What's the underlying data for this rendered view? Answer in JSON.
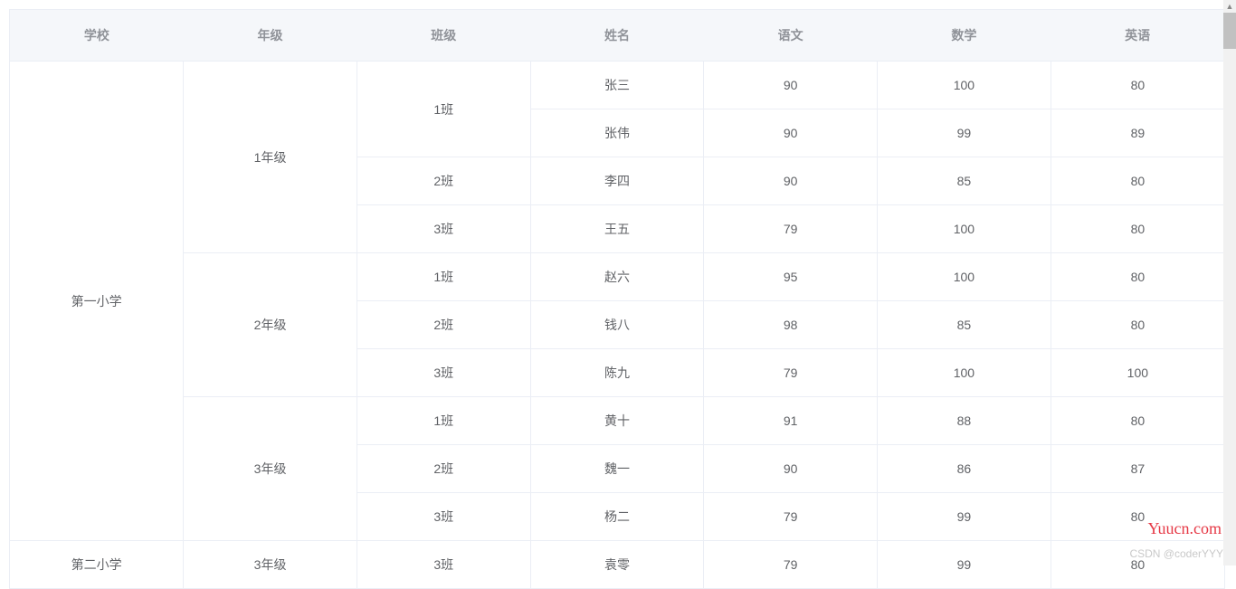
{
  "table": {
    "headers": [
      "学校",
      "年级",
      "班级",
      "姓名",
      "语文",
      "数学",
      "英语"
    ],
    "rows": [
      {
        "school": "第一小学",
        "schoolRowspan": 10,
        "grade": "1年级",
        "gradeRowspan": 4,
        "class": "1班",
        "classRowspan": 2,
        "name": "张三",
        "chinese": "90",
        "math": "100",
        "english": "80"
      },
      {
        "name": "张伟",
        "chinese": "90",
        "math": "99",
        "english": "89"
      },
      {
        "class": "2班",
        "classRowspan": 1,
        "name": "李四",
        "chinese": "90",
        "math": "85",
        "english": "80"
      },
      {
        "class": "3班",
        "classRowspan": 1,
        "name": "王五",
        "chinese": "79",
        "math": "100",
        "english": "80"
      },
      {
        "grade": "2年级",
        "gradeRowspan": 3,
        "class": "1班",
        "classRowspan": 1,
        "name": "赵六",
        "chinese": "95",
        "math": "100",
        "english": "80"
      },
      {
        "class": "2班",
        "classRowspan": 1,
        "name": "钱八",
        "chinese": "98",
        "math": "85",
        "english": "80"
      },
      {
        "class": "3班",
        "classRowspan": 1,
        "name": "陈九",
        "chinese": "79",
        "math": "100",
        "english": "100"
      },
      {
        "grade": "3年级",
        "gradeRowspan": 3,
        "class": "1班",
        "classRowspan": 1,
        "name": "黄十",
        "chinese": "91",
        "math": "88",
        "english": "80"
      },
      {
        "class": "2班",
        "classRowspan": 1,
        "name": "魏一",
        "chinese": "90",
        "math": "86",
        "english": "87"
      },
      {
        "class": "3班",
        "classRowspan": 1,
        "name": "杨二",
        "chinese": "79",
        "math": "99",
        "english": "80"
      },
      {
        "school": "第二小学",
        "schoolRowspan": 1,
        "grade": "3年级",
        "gradeRowspan": 1,
        "class": "3班",
        "classRowspan": 1,
        "name": "袁零",
        "chinese": "79",
        "math": "99",
        "english": "80"
      }
    ]
  },
  "watermark": "Yuucn.com",
  "watermark2": "CSDN @coderYYY"
}
